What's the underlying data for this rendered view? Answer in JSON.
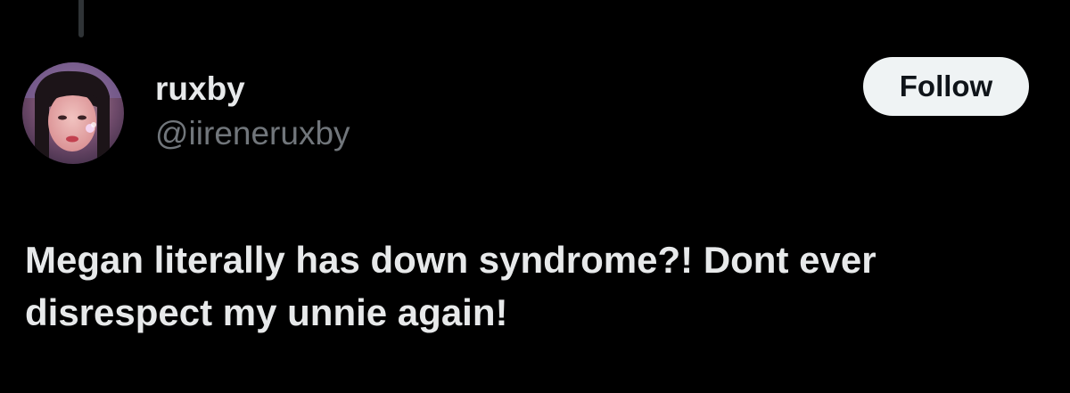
{
  "tweet": {
    "author": {
      "display_name": "ruxby",
      "handle": "@iireneruxby",
      "avatar_icon": "profile-photo"
    },
    "follow_label": "Follow",
    "text": "Megan literally has down syndrome?! Dont ever disrespect my unnie again!"
  },
  "colors": {
    "background": "#000000",
    "primary_text": "#e7e9ea",
    "secondary_text": "#71767b",
    "button_bg": "#eff3f4",
    "button_text": "#0f1419",
    "thread_line": "#2f3336"
  }
}
